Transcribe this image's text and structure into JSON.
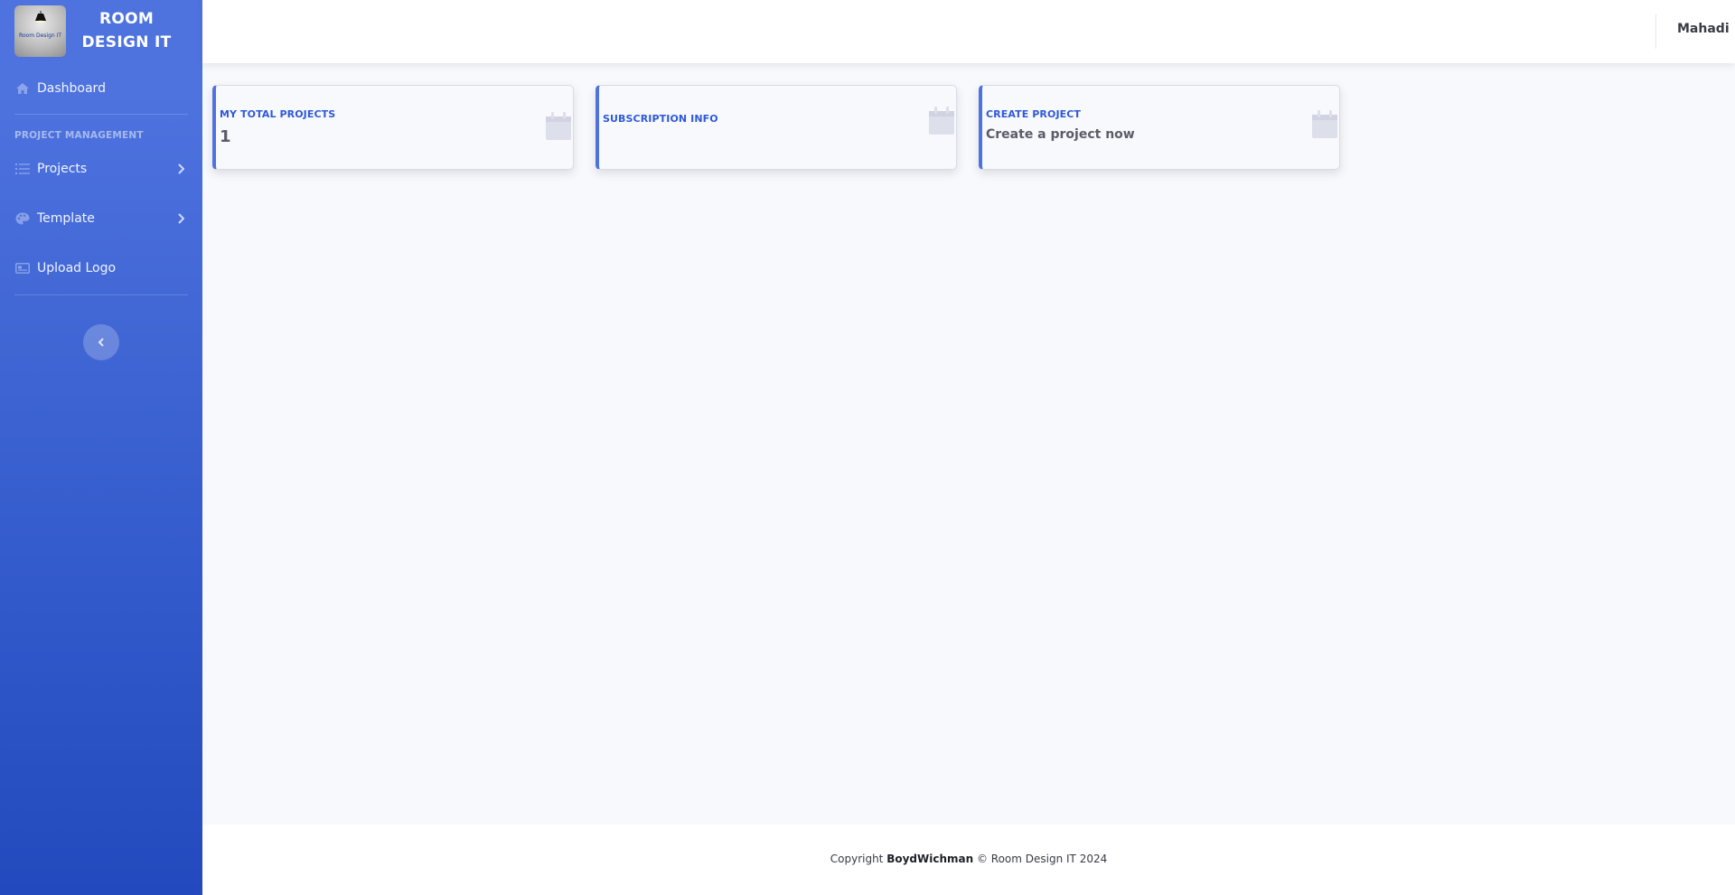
{
  "brand": {
    "name": "ROOM\nDESIGN IT",
    "logo_text": "Room Design IT"
  },
  "sidebar": {
    "dashboard_label": "Dashboard",
    "section_heading": "PROJECT MANAGEMENT",
    "items": [
      {
        "label": "Projects",
        "icon": "list-icon",
        "has_submenu": true
      },
      {
        "label": "Template",
        "icon": "palette-icon",
        "has_submenu": true
      },
      {
        "label": "Upload Logo",
        "icon": "image-icon",
        "has_submenu": false
      }
    ]
  },
  "topbar": {
    "user_name": "Mahadi"
  },
  "cards": [
    {
      "title": "MY TOTAL PROJECTS",
      "value": "1",
      "icon": "calendar-icon"
    },
    {
      "title": "SUBSCRIPTION INFO",
      "value": "",
      "icon": "calendar-icon"
    },
    {
      "title": "CREATE PROJECT",
      "value": "Create a project now",
      "icon": "calendar-icon"
    }
  ],
  "footer": {
    "prefix": "Copyright ",
    "owner": "BoydWichman",
    "suffix": " © Room Design IT 2024"
  },
  "colors": {
    "primary": "#4e73df",
    "primary_dark": "#224abe",
    "card_title": "#2e59d9",
    "icon_muted": "#dddfeb"
  }
}
